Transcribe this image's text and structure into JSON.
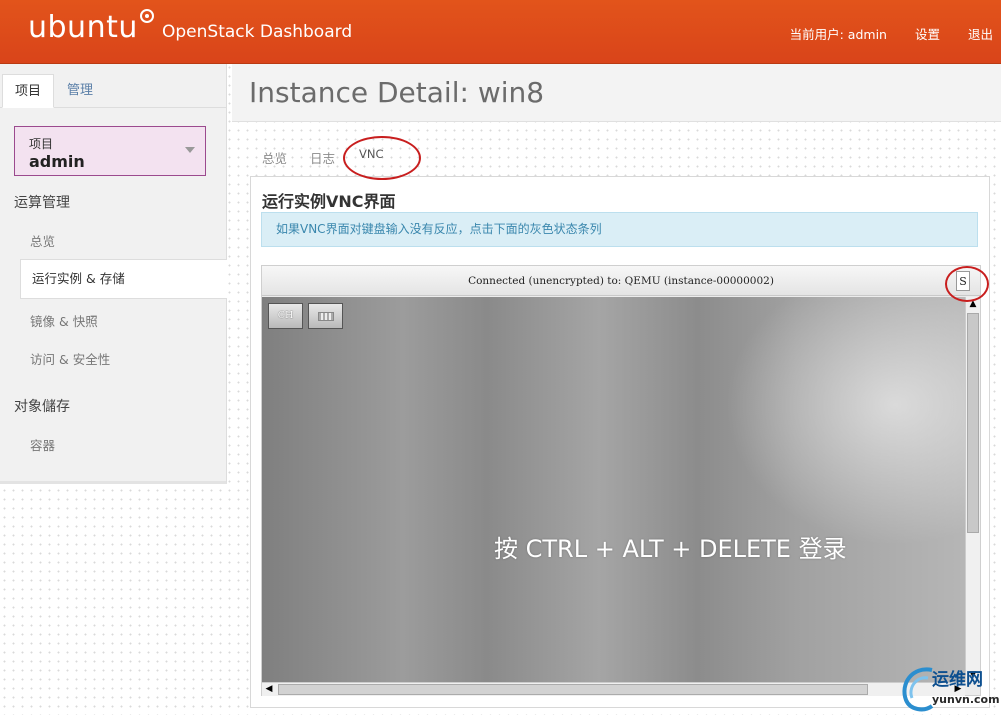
{
  "header": {
    "logo_text": "ubuntu",
    "app_title": "OpenStack Dashboard",
    "current_user": "当前用户: admin",
    "settings_label": "设置",
    "logout_label": "退出"
  },
  "sidebar": {
    "tabs": [
      "项目",
      "管理"
    ],
    "project_label": "项目",
    "project_value": "admin",
    "sections": [
      {
        "header": "运算管理",
        "items": [
          "总览",
          "运行实例 & 存储",
          "镜像 & 快照",
          "访问 & 安全性"
        ]
      },
      {
        "header": "对象儲存",
        "items": [
          "容器"
        ]
      }
    ]
  },
  "page": {
    "title": "Instance Detail: win8",
    "tabs": [
      "总览",
      "日志",
      "VNC"
    ],
    "section_title": "运行实例VNC界面",
    "info_message": "如果VNC界面对键盘输入没有反应，点击下面的灰色状态条列"
  },
  "vnc": {
    "status_text": "Connected (unencrypted) to: QEMU (instance-00000002)",
    "status_button": "S",
    "ch_button": "CH",
    "login_message": "按 CTRL + ALT + DELETE 登录",
    "scroll_up": "▲",
    "scroll_down": "▼",
    "scroll_left": "◀",
    "scroll_right": "▶"
  },
  "watermark": {
    "title": "运维网",
    "domain": "yunvn.com"
  },
  "colors": {
    "brand": "#dd4814",
    "accent_alert": "#daeef6",
    "annotation": "#c81e1e"
  }
}
